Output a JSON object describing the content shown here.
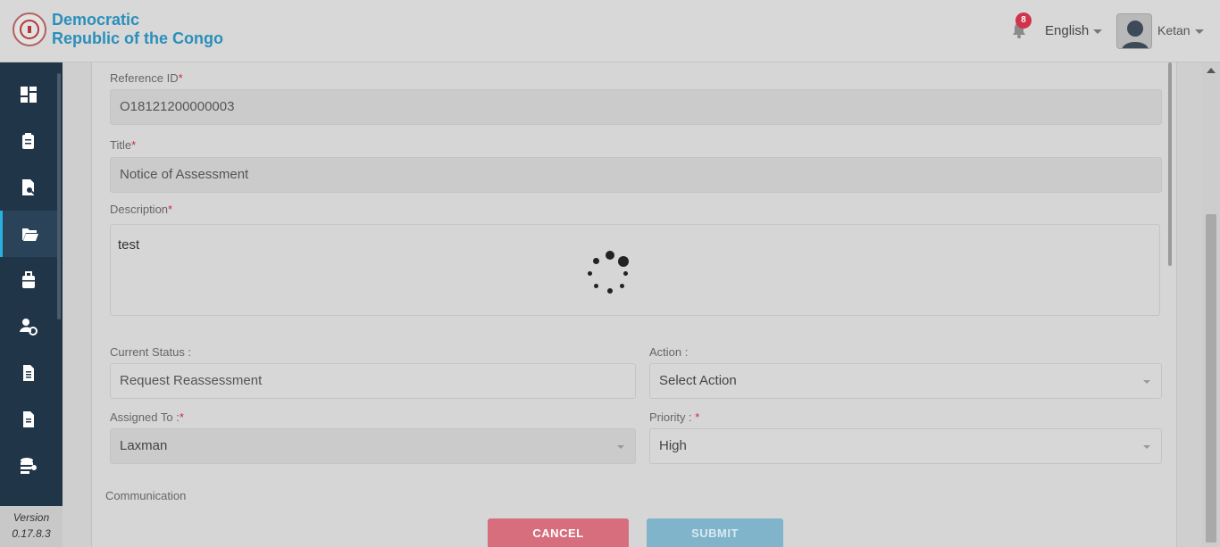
{
  "header": {
    "brand_line1": "Democratic",
    "brand_line2": "Republic of the Congo",
    "notification_count": "8",
    "language": "English",
    "user_name": "Ketan"
  },
  "sidebar": {
    "items": [
      {
        "icon": "dashboard-icon"
      },
      {
        "icon": "clipboard-icon"
      },
      {
        "icon": "document-search-icon"
      },
      {
        "icon": "folder-open-icon",
        "active": true
      },
      {
        "icon": "briefcase-icon"
      },
      {
        "icon": "user-settings-icon"
      },
      {
        "icon": "file-icon"
      },
      {
        "icon": "file-list-icon"
      },
      {
        "icon": "database-user-icon"
      }
    ],
    "version_label": "Version",
    "version_number": "0.17.8.3"
  },
  "form": {
    "reference_id_label": "Reference ID",
    "reference_id_value": "O18121200000003",
    "title_label": "Title",
    "title_value": "Notice of Assessment",
    "description_label": "Description",
    "description_value": "test",
    "current_status_label": "Current Status :",
    "current_status_value": "Request Reassessment",
    "action_label": "Action :",
    "action_value": "Select Action",
    "assigned_to_label": "Assigned To :",
    "assigned_to_value": "Laxman",
    "priority_label": "Priority :",
    "priority_value": "High",
    "communication_label": "Communication",
    "required_mark": "*",
    "cancel_label": "CANCEL",
    "submit_label": "SUBMIT"
  }
}
